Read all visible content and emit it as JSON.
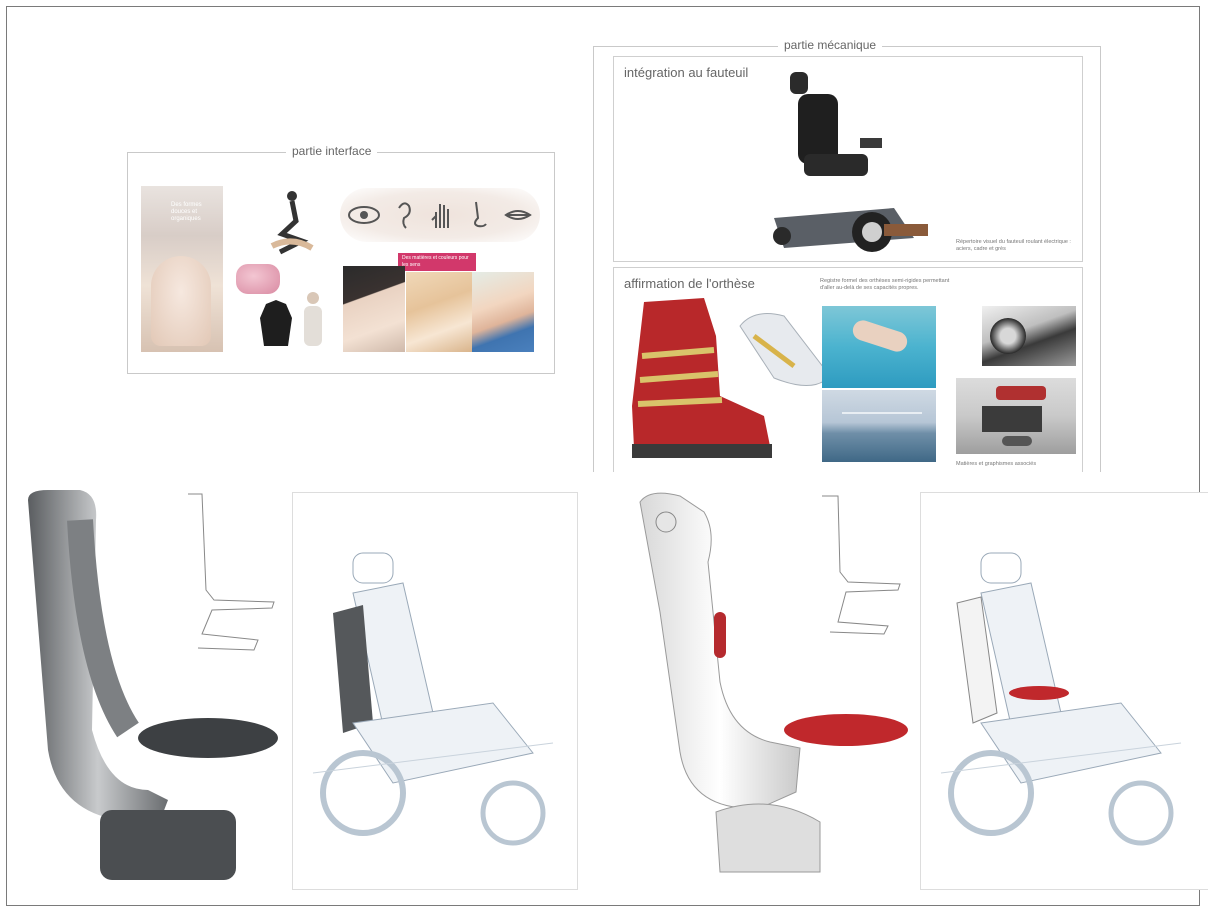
{
  "interface_panel": {
    "legend": "partie interface",
    "pink_label": "Des matières et couleurs pour les sens",
    "side_text": "Des formes douces et organiques",
    "senses_icons": [
      "eye-icon",
      "ear-icon",
      "hand-icon",
      "nose-icon",
      "mouth-icon"
    ]
  },
  "mechanical_panel": {
    "legend": "partie mécanique",
    "integration_title": "intégration au fauteuil",
    "integration_note": "Répertoire visuel du fauteuil roulant électrique : aciers, cadre et grès",
    "affirmation_title": "affirmation de l'orthèse",
    "affirmation_note": "Registre formel des orthèses semi-rigides permettant d'aller au-delà de ses capacités propres.",
    "materials_note": "Matières et graphismes associés"
  },
  "colors": {
    "accent_pink": "#d2386b",
    "orthosis_red": "#c0282c",
    "metal_grey": "#8a8d90"
  }
}
